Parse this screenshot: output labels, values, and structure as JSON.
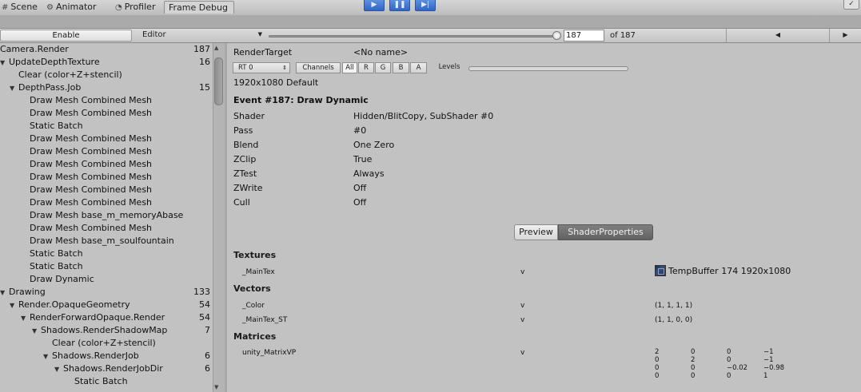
{
  "tabs": [
    {
      "label": "Scene",
      "icon": "scene-icon",
      "glyph": "#"
    },
    {
      "label": "Animator",
      "icon": "animator-icon",
      "glyph": "⚙"
    },
    {
      "label": "Profiler",
      "icon": "profiler-icon",
      "glyph": "◔"
    },
    {
      "label": "Frame Debug",
      "icon": "",
      "glyph": ""
    }
  ],
  "play_controls": [
    {
      "icon": "play-icon",
      "glyph": "▶"
    },
    {
      "icon": "pause-icon",
      "glyph": "❚❚"
    },
    {
      "icon": "step-icon",
      "glyph": "▶|"
    }
  ],
  "toolbar": {
    "enable_label": "Enable",
    "editor_label": "Editor",
    "frame_value": "187",
    "of_label": "of 187",
    "slider_fraction": 1.0,
    "prev_glyph": "◀",
    "next_glyph": "▶"
  },
  "tree": [
    {
      "label": "Camera.Render",
      "count": "187",
      "depth": 0,
      "expanded": null
    },
    {
      "label": "UpdateDepthTexture",
      "count": "16",
      "depth": 0,
      "expanded": true
    },
    {
      "label": "Clear (color+Z+stencil)",
      "count": "",
      "depth": 1,
      "expanded": null
    },
    {
      "label": "DepthPass.Job",
      "count": "15",
      "depth": 1,
      "expanded": true
    },
    {
      "label": "Draw Mesh Combined Mesh",
      "count": "",
      "depth": 2,
      "expanded": null
    },
    {
      "label": "Draw Mesh Combined Mesh",
      "count": "",
      "depth": 2,
      "expanded": null
    },
    {
      "label": "Static Batch",
      "count": "",
      "depth": 2,
      "expanded": null
    },
    {
      "label": "Draw Mesh Combined Mesh",
      "count": "",
      "depth": 2,
      "expanded": null
    },
    {
      "label": "Draw Mesh Combined Mesh",
      "count": "",
      "depth": 2,
      "expanded": null
    },
    {
      "label": "Draw Mesh Combined Mesh",
      "count": "",
      "depth": 2,
      "expanded": null
    },
    {
      "label": "Draw Mesh Combined Mesh",
      "count": "",
      "depth": 2,
      "expanded": null
    },
    {
      "label": "Draw Mesh Combined Mesh",
      "count": "",
      "depth": 2,
      "expanded": null
    },
    {
      "label": "Draw Mesh Combined Mesh",
      "count": "",
      "depth": 2,
      "expanded": null
    },
    {
      "label": "Draw Mesh base_m_memoryAbase",
      "count": "",
      "depth": 2,
      "expanded": null
    },
    {
      "label": "Draw Mesh Combined Mesh",
      "count": "",
      "depth": 2,
      "expanded": null
    },
    {
      "label": "Draw Mesh base_m_soulfountain",
      "count": "",
      "depth": 2,
      "expanded": null
    },
    {
      "label": "Static Batch",
      "count": "",
      "depth": 2,
      "expanded": null
    },
    {
      "label": "Static Batch",
      "count": "",
      "depth": 2,
      "expanded": null
    },
    {
      "label": "Draw Dynamic",
      "count": "",
      "depth": 2,
      "expanded": null
    },
    {
      "label": "Drawing",
      "count": "133",
      "depth": 0,
      "expanded": true
    },
    {
      "label": "Render.OpaqueGeometry",
      "count": "54",
      "depth": 1,
      "expanded": true
    },
    {
      "label": "RenderForwardOpaque.Render",
      "count": "54",
      "depth": 2,
      "expanded": true
    },
    {
      "label": "Shadows.RenderShadowMap",
      "count": "7",
      "depth": 3,
      "expanded": true
    },
    {
      "label": "Clear (color+Z+stencil)",
      "count": "",
      "depth": 4,
      "expanded": null
    },
    {
      "label": "Shadows.RenderJob",
      "count": "6",
      "depth": 4,
      "expanded": true
    },
    {
      "label": "Shadows.RenderJobDir",
      "count": "6",
      "depth": 5,
      "expanded": true
    },
    {
      "label": "Static Batch",
      "count": "",
      "depth": 6,
      "expanded": null
    }
  ],
  "detail": {
    "render_target_label": "RenderTarget",
    "render_target_value": "<No name>",
    "rt_select": "RT 0",
    "channels_label": "Channels",
    "channels": [
      "All",
      "R",
      "G",
      "B",
      "A"
    ],
    "levels_label": "Levels",
    "resolution": "1920x1080 Default",
    "event_title": "Event #187: Draw Dynamic",
    "properties": [
      {
        "key": "Shader",
        "value": "Hidden/BlitCopy, SubShader #0"
      },
      {
        "key": "Pass",
        "value": "#0"
      },
      {
        "key": "Blend",
        "value": "One Zero"
      },
      {
        "key": "ZClip",
        "value": "True"
      },
      {
        "key": "ZTest",
        "value": "Always"
      },
      {
        "key": "ZWrite",
        "value": "Off"
      },
      {
        "key": "Cull",
        "value": "Off"
      }
    ],
    "preview_tab": "Preview",
    "shaderprops_tab": "ShaderProperties",
    "textures_header": "Textures",
    "textures": [
      {
        "name": "_MainTex",
        "stage": "v",
        "value": "TempBuffer 174 1920x1080"
      }
    ],
    "vectors_header": "Vectors",
    "vectors": [
      {
        "name": "_Color",
        "stage": "v",
        "value": "(1, 1, 1, 1)"
      },
      {
        "name": "_MainTex_ST",
        "stage": "v",
        "value": "(1, 1, 0, 0)"
      }
    ],
    "matrices_header": "Matrices",
    "matrices": [
      {
        "name": "unity_MatrixVP",
        "stage": "v",
        "rows": [
          [
            "2",
            "0",
            "0",
            "−1"
          ],
          [
            "0",
            "2",
            "0",
            "−1"
          ],
          [
            "0",
            "0",
            "−0.02",
            "−0.98"
          ],
          [
            "0",
            "0",
            "0",
            "1"
          ]
        ]
      }
    ]
  }
}
